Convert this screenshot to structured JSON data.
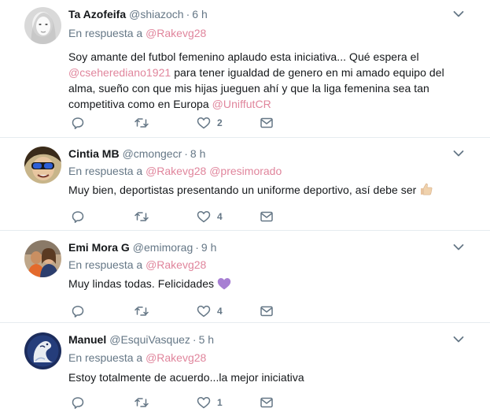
{
  "tweets": [
    {
      "fullname": "Ta Azofeifa",
      "username": "@shiazoch",
      "dot": "·",
      "time": "6 h",
      "reply_prefix": "En respuesta a",
      "reply_mentions": [
        "@Rakevg28"
      ],
      "text_parts": [
        {
          "t": "Soy amante del futbol femenino aplaudo esta iniciativa... Qué espera el ",
          "m": false
        },
        {
          "t": "@cseherediano1921",
          "m": true
        },
        {
          "t": " para tener igualdad de genero en mi amado equipo del alma, sueño con que mis hijas jueguen ahí y que la liga femenina sea tan competitiva como en Europa ",
          "m": false
        },
        {
          "t": "@UniffutCR",
          "m": true
        }
      ],
      "likes": "2",
      "avatar": "avatar-ta-azofeifa"
    },
    {
      "fullname": "Cintia MB",
      "username": "@cmongecr",
      "dot": "·",
      "time": "8 h",
      "reply_prefix": "En respuesta a",
      "reply_mentions": [
        "@Rakevg28",
        "@presimorado"
      ],
      "text_parts": [
        {
          "t": "Muy bien, deportistas presentando un uniforme deportivo, así debe ser",
          "m": false
        }
      ],
      "emoji": "thumbs-up-emoji",
      "likes": "4",
      "avatar": "avatar-cintia-mb"
    },
    {
      "fullname": "Emi Mora G",
      "username": "@emimorag",
      "dot": "·",
      "time": "9 h",
      "reply_prefix": "En respuesta a",
      "reply_mentions": [
        "@Rakevg28"
      ],
      "text_parts": [
        {
          "t": "Muy lindas todas. Felicidades",
          "m": false
        }
      ],
      "emoji": "purple-heart-emoji",
      "likes": "4",
      "avatar": "avatar-emi-mora"
    },
    {
      "fullname": "Manuel",
      "username": "@EsquiVasquez",
      "dot": "·",
      "time": "5 h",
      "reply_prefix": "En respuesta a",
      "reply_mentions": [
        "@Rakevg28"
      ],
      "text_parts": [
        {
          "t": "Estoy totalmente de acuerdo...la mejor iniciativa",
          "m": false
        }
      ],
      "likes": "1",
      "avatar": "avatar-manuel"
    }
  ],
  "colors": {
    "mention": "#e0859c",
    "muted": "#657786",
    "text": "#14171a",
    "divider": "#e6ecf0",
    "like_heart": "#657786"
  },
  "icons": [
    "reply-icon",
    "retweet-icon",
    "like-icon",
    "message-icon",
    "chevron-down-icon"
  ]
}
